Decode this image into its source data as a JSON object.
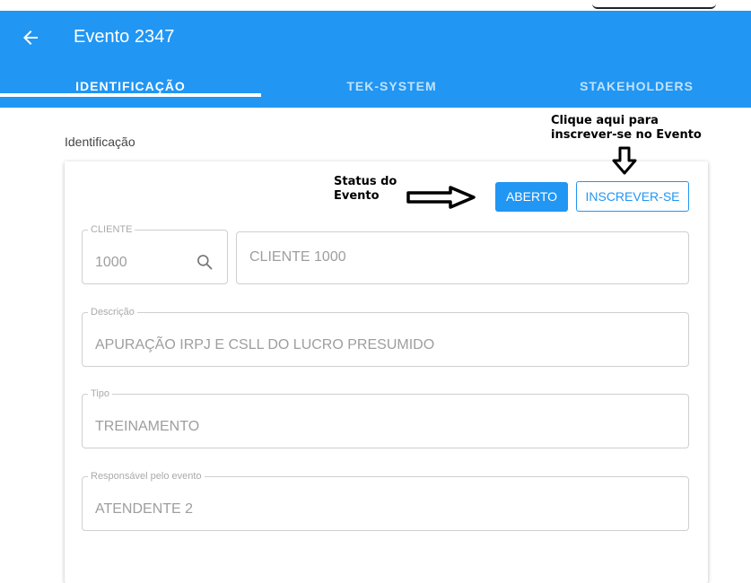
{
  "header": {
    "title": "Evento 2347"
  },
  "tabs": [
    {
      "label": "IDENTIFICAÇÃO"
    },
    {
      "label": "TEK-SYSTEM"
    },
    {
      "label": "STAKEHOLDERS"
    }
  ],
  "section": {
    "label": "Identificação"
  },
  "status": {
    "button_label": "ABERTO"
  },
  "actions": {
    "subscribe_label": "INSCREVER-SE"
  },
  "annotations": {
    "status_l1": "Status do",
    "status_l2": "Evento",
    "click_l1": "Clique aqui para",
    "click_l2": "inscrever-se no Evento"
  },
  "form": {
    "cliente": {
      "label": "CLIENTE",
      "code": "1000",
      "name": "CLIENTE 1000"
    },
    "descricao": {
      "label": "Descrição",
      "value": "APURAÇÃO IRPJ E CSLL DO LUCRO PRESUMIDO"
    },
    "tipo": {
      "label": "Tipo",
      "value": "TREINAMENTO"
    },
    "responsavel": {
      "label": "Responsável pelo evento",
      "value": "ATENDENTE 2"
    }
  },
  "colors": {
    "primary": "#2196f3",
    "text_muted": "#9e9e9e",
    "border": "#cfcfcf"
  },
  "icons": [
    "arrow-left-icon",
    "search-icon",
    "arrow-right-annotation-icon",
    "arrow-down-annotation-icon"
  ]
}
